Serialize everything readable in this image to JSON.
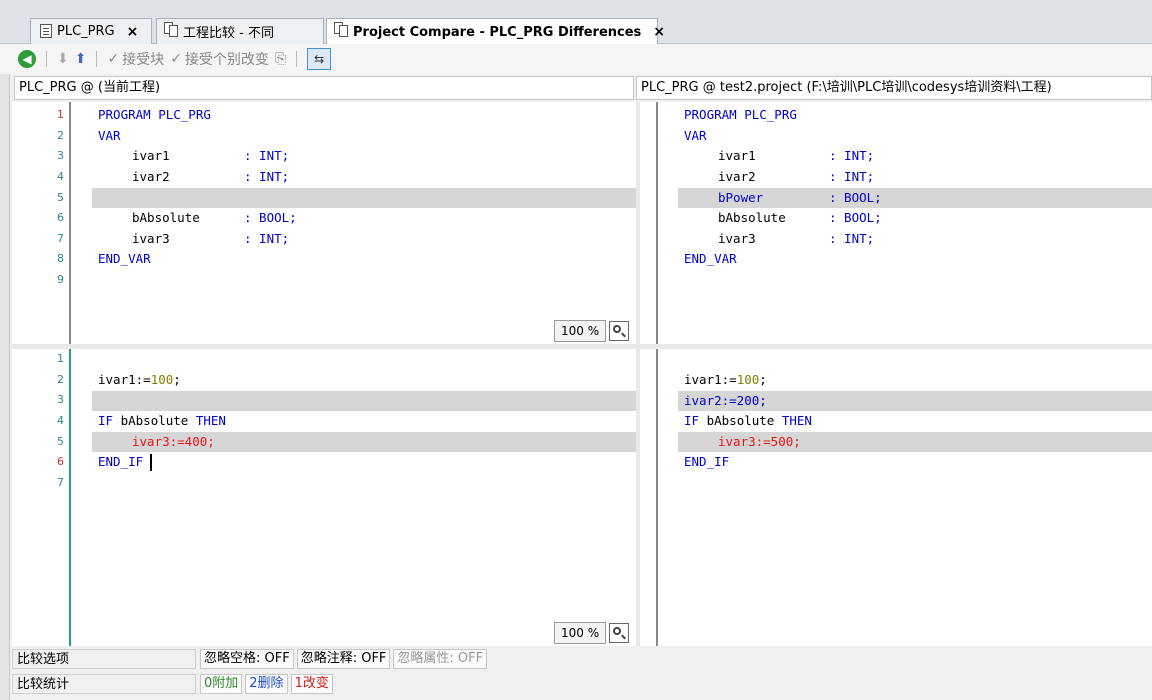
{
  "tabs": [
    {
      "label": "PLC_PRG",
      "close": "×"
    },
    {
      "label": "工程比较 - 不同"
    },
    {
      "label": "Project Compare - PLC_PRG Differences",
      "close": "×"
    }
  ],
  "toolbar": {
    "accept_block": "接受块",
    "accept_change": "接受个别改变"
  },
  "left_header": "PLC_PRG @ (当前工程)",
  "right_header": "PLC_PRG @ test2.project (F:\\培训\\PLC培训\\codesys培训资料\\工程)",
  "zoom_top": "100 %",
  "zoom_bottom": "100 %",
  "decl": {
    "left_line_numbers": [
      "1",
      "2",
      "3",
      "4",
      "5",
      "6",
      "7",
      "8",
      "9"
    ],
    "lines_left": [
      "PROGRAM PLC_PRG",
      "VAR",
      "ivar1",
      "ivar2",
      "",
      "bAbsolute",
      "ivar3",
      "END_VAR"
    ],
    "lines_right": [
      "PROGRAM PLC_PRG",
      "VAR",
      "ivar1",
      "ivar2",
      "bPower",
      "bAbsolute",
      "ivar3",
      "END_VAR"
    ],
    "type_int": ": INT;",
    "type_bool": ": BOOL;"
  },
  "impl": {
    "left_line_numbers": [
      "1",
      "2",
      "3",
      "4",
      "5",
      "6",
      "7"
    ],
    "left": {
      "l2_var": "ivar1:=",
      "l2_num": "100",
      "l2_end": ";",
      "l4_if": "IF",
      "l4_mid": " bAbsolute ",
      "l4_then": "THEN",
      "l5": "ivar3:=400;",
      "l6": "END_IF"
    },
    "right": {
      "l2_var": "ivar1:=",
      "l2_num": "100",
      "l2_end": ";",
      "l3": "ivar2:=200;",
      "l4_if": "IF",
      "l4_mid": " bAbsolute ",
      "l4_then": "THEN",
      "l5": "ivar3:=500;",
      "l6": "END_IF"
    }
  },
  "status": {
    "compare_options_label": "比较选项",
    "ignore_whitespace": "忽略空格: OFF",
    "ignore_comments": "忽略注释: OFF",
    "ignore_properties": "忽略属性: OFF",
    "compare_stats_label": "比较统计",
    "added": "0附加",
    "deleted": "2删除",
    "changed": "1改变"
  }
}
